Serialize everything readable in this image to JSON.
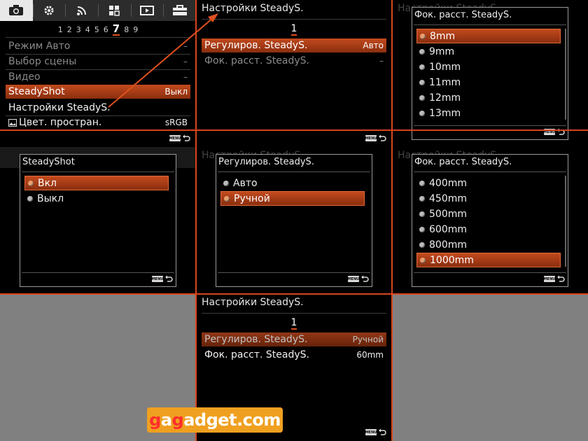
{
  "main_menu": {
    "tabs": [
      "camera-icon",
      "gear-icon",
      "wireless-icon",
      "grid-icon",
      "playback-icon",
      "toolbox-icon"
    ],
    "pages": [
      "1",
      "2",
      "3",
      "4",
      "5",
      "6",
      "7",
      "8",
      "9"
    ],
    "current_page": "7",
    "items": [
      {
        "label": "Режим Авто",
        "value": "–"
      },
      {
        "label": "Выбор сцены",
        "value": "–"
      },
      {
        "label": "Видео",
        "value": "–"
      },
      {
        "label": "SteadyShot",
        "value": "Выкл"
      },
      {
        "label": "Настройки SteadyS.",
        "value": ""
      },
      {
        "label": "Цвет. простран.",
        "value": "sRGB"
      }
    ]
  },
  "steady_menu": {
    "title": "Настройки SteadyS.",
    "page": "1",
    "items": [
      {
        "label": "Регулиров. SteadyS.",
        "value": "Авто"
      },
      {
        "label": "Фок. расст. SteadyS.",
        "value": "–"
      }
    ]
  },
  "focal_popup_1": {
    "title": "Фок. расст. SteadyS.",
    "options": [
      "8mm",
      "9mm",
      "10mm",
      "11mm",
      "12mm",
      "13mm"
    ]
  },
  "steadyshot_popup": {
    "title": "SteadyShot",
    "options": [
      "Вкл",
      "Выкл"
    ]
  },
  "regul_popup": {
    "title": "Регулиров. SteadyS.",
    "options": [
      "Авто",
      "Ручной"
    ]
  },
  "focal_popup_2": {
    "title": "Фок. расст. SteadyS.",
    "options": [
      "400mm",
      "450mm",
      "500mm",
      "600mm",
      "800mm",
      "1000mm"
    ]
  },
  "steady_menu_final": {
    "title": "Настройки SteadyS.",
    "page": "1",
    "items": [
      {
        "label": "Регулиров. SteadyS.",
        "value": "Ручной"
      },
      {
        "label": "Фок. расст. SteadyS.",
        "value": "60mm"
      }
    ]
  },
  "ghost": {
    "title_top": "Настройки SteadyS.",
    "title_mid": "Настройки SteadyS.",
    "title_right": "Настройки SteadyS."
  },
  "footer_menu_label": "MENU",
  "brand": {
    "g1": "g",
    "a": "a",
    "g2": "g",
    "rest": "adget.com"
  },
  "colors": {
    "accent": "#d8441c",
    "selection": "#c24a1e"
  }
}
